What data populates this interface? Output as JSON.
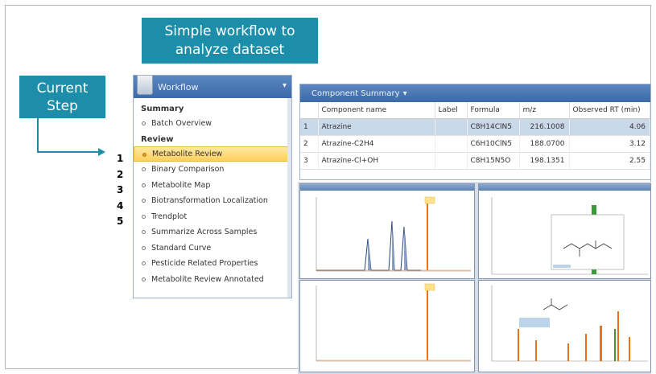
{
  "callouts": {
    "workflow": "Simple workflow to analyze dataset",
    "workflow_line1": "Simple workflow to",
    "workflow_line2": "analyze dataset",
    "current_step_line1": "Current",
    "current_step_line2": "Step"
  },
  "step_numbers": [
    "1",
    "2",
    "3",
    "4",
    "5"
  ],
  "workflow": {
    "title": "Workflow",
    "sections": [
      {
        "label": "Summary",
        "items": [
          "Batch Overview"
        ]
      },
      {
        "label": "Review",
        "items": [
          "Metabolite Review",
          "Binary Comparison",
          "Metabolite Map",
          "Biotransformation Localization",
          "Trendplot",
          "Summarize Across Samples",
          "Standard Curve",
          "Pesticide Related Properties",
          "Metabolite Review Annotated"
        ]
      }
    ],
    "active_item": "Metabolite Review"
  },
  "component_summary": {
    "title": "Component Summary",
    "columns": [
      "",
      "Component name",
      "Label",
      "Formula",
      "m/z",
      "Observed RT (min)"
    ],
    "rows": [
      {
        "index": "1",
        "name": "Atrazine",
        "label": "",
        "formula": "C8H14ClN5",
        "mz": "216.1008",
        "rt": "4.06"
      },
      {
        "index": "2",
        "name": "Atrazine-C2H4",
        "label": "",
        "formula": "C6H10ClN5",
        "mz": "188.0700",
        "rt": "3.12"
      },
      {
        "index": "3",
        "name": "Atrazine-Cl+OH",
        "label": "",
        "formula": "C8H15N5O",
        "mz": "198.1351",
        "rt": "2.55"
      }
    ],
    "selected_row": 1
  },
  "colors": {
    "callout": "#1c8eaa",
    "header": "#3c6aa8",
    "active_step": "#ffcf5e",
    "trace_blue": "#24457a",
    "trace_orange": "#e8731a",
    "trace_green": "#3a9a3a"
  }
}
